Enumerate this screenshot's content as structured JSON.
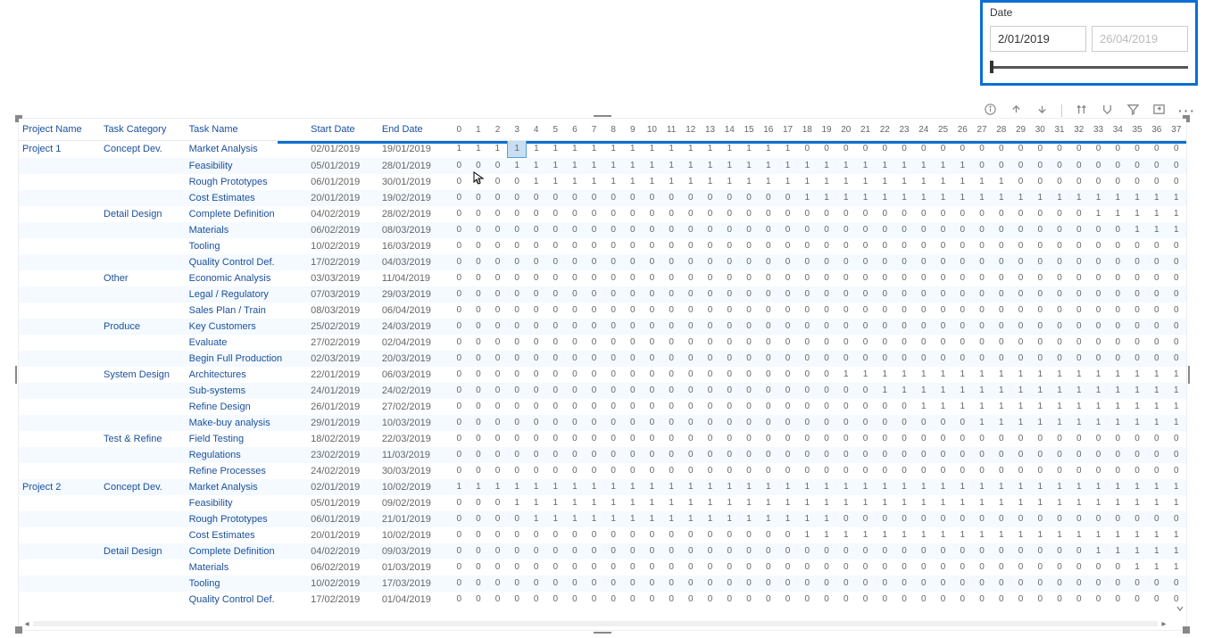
{
  "slicer": {
    "title": "Date",
    "from": "2/01/2019",
    "to": "26/04/2019"
  },
  "toolbar_icons": [
    "arrow-up",
    "arrow-down",
    "divider",
    "drill",
    "filter",
    "focus",
    "more"
  ],
  "headers": {
    "project": "Project Name",
    "category": "Task Category",
    "task": "Task Name",
    "start": "Start Date",
    "end": "End Date"
  },
  "dayColumns": [
    0,
    1,
    2,
    3,
    4,
    5,
    6,
    7,
    8,
    9,
    10,
    11,
    12,
    13,
    14,
    15,
    16,
    17,
    18,
    19,
    20,
    21,
    22,
    23,
    24,
    25,
    26,
    27,
    28,
    29,
    30,
    31,
    32,
    33,
    34,
    35,
    36,
    37
  ],
  "selectedCell": {
    "rowIndex": 0,
    "dayIndex": 3
  },
  "rows": [
    {
      "project": "Project 1",
      "category": "Concept Dev.",
      "task": "Market Analysis",
      "start": "02/01/2019",
      "end": "19/01/2019",
      "vals": [
        1,
        1,
        1,
        1,
        1,
        1,
        1,
        1,
        1,
        1,
        1,
        1,
        1,
        1,
        1,
        1,
        1,
        1,
        0,
        0,
        0,
        0,
        0,
        0,
        0,
        0,
        0,
        0,
        0,
        0,
        0,
        0,
        0,
        0,
        0,
        0,
        0,
        0
      ]
    },
    {
      "project": "",
      "category": "",
      "task": "Feasibility",
      "start": "05/01/2019",
      "end": "28/01/2019",
      "vals": [
        0,
        0,
        0,
        1,
        1,
        1,
        1,
        1,
        1,
        1,
        1,
        1,
        1,
        1,
        1,
        1,
        1,
        1,
        1,
        1,
        1,
        1,
        1,
        1,
        1,
        1,
        1,
        0,
        0,
        0,
        0,
        0,
        0,
        0,
        0,
        0,
        0,
        0
      ]
    },
    {
      "project": "",
      "category": "",
      "task": "Rough Prototypes",
      "start": "06/01/2019",
      "end": "30/01/2019",
      "vals": [
        0,
        0,
        0,
        0,
        1,
        1,
        1,
        1,
        1,
        1,
        1,
        1,
        1,
        1,
        1,
        1,
        1,
        1,
        1,
        1,
        1,
        1,
        1,
        1,
        1,
        1,
        1,
        1,
        1,
        0,
        0,
        0,
        0,
        0,
        0,
        0,
        0,
        0
      ]
    },
    {
      "project": "",
      "category": "",
      "task": "Cost Estimates",
      "start": "20/01/2019",
      "end": "19/02/2019",
      "vals": [
        0,
        0,
        0,
        0,
        0,
        0,
        0,
        0,
        0,
        0,
        0,
        0,
        0,
        0,
        0,
        0,
        0,
        0,
        1,
        1,
        1,
        1,
        1,
        1,
        1,
        1,
        1,
        1,
        1,
        1,
        1,
        1,
        1,
        1,
        1,
        1,
        1,
        1
      ]
    },
    {
      "project": "",
      "category": "Detail Design",
      "task": "Complete Definition",
      "start": "04/02/2019",
      "end": "28/02/2019",
      "vals": [
        0,
        0,
        0,
        0,
        0,
        0,
        0,
        0,
        0,
        0,
        0,
        0,
        0,
        0,
        0,
        0,
        0,
        0,
        0,
        0,
        0,
        0,
        0,
        0,
        0,
        0,
        0,
        0,
        0,
        0,
        0,
        0,
        0,
        1,
        1,
        1,
        1,
        1
      ]
    },
    {
      "project": "",
      "category": "",
      "task": "Materials",
      "start": "06/02/2019",
      "end": "08/03/2019",
      "vals": [
        0,
        0,
        0,
        0,
        0,
        0,
        0,
        0,
        0,
        0,
        0,
        0,
        0,
        0,
        0,
        0,
        0,
        0,
        0,
        0,
        0,
        0,
        0,
        0,
        0,
        0,
        0,
        0,
        0,
        0,
        0,
        0,
        0,
        0,
        0,
        1,
        1,
        1
      ]
    },
    {
      "project": "",
      "category": "",
      "task": "Tooling",
      "start": "10/02/2019",
      "end": "16/03/2019",
      "vals": [
        0,
        0,
        0,
        0,
        0,
        0,
        0,
        0,
        0,
        0,
        0,
        0,
        0,
        0,
        0,
        0,
        0,
        0,
        0,
        0,
        0,
        0,
        0,
        0,
        0,
        0,
        0,
        0,
        0,
        0,
        0,
        0,
        0,
        0,
        0,
        0,
        0,
        0
      ]
    },
    {
      "project": "",
      "category": "",
      "task": "Quality Control Def.",
      "start": "17/02/2019",
      "end": "04/03/2019",
      "vals": [
        0,
        0,
        0,
        0,
        0,
        0,
        0,
        0,
        0,
        0,
        0,
        0,
        0,
        0,
        0,
        0,
        0,
        0,
        0,
        0,
        0,
        0,
        0,
        0,
        0,
        0,
        0,
        0,
        0,
        0,
        0,
        0,
        0,
        0,
        0,
        0,
        0,
        0
      ]
    },
    {
      "project": "",
      "category": "Other",
      "task": "Economic Analysis",
      "start": "03/03/2019",
      "end": "11/04/2019",
      "vals": [
        0,
        0,
        0,
        0,
        0,
        0,
        0,
        0,
        0,
        0,
        0,
        0,
        0,
        0,
        0,
        0,
        0,
        0,
        0,
        0,
        0,
        0,
        0,
        0,
        0,
        0,
        0,
        0,
        0,
        0,
        0,
        0,
        0,
        0,
        0,
        0,
        0,
        0
      ]
    },
    {
      "project": "",
      "category": "",
      "task": "Legal / Regulatory",
      "start": "07/03/2019",
      "end": "29/03/2019",
      "vals": [
        0,
        0,
        0,
        0,
        0,
        0,
        0,
        0,
        0,
        0,
        0,
        0,
        0,
        0,
        0,
        0,
        0,
        0,
        0,
        0,
        0,
        0,
        0,
        0,
        0,
        0,
        0,
        0,
        0,
        0,
        0,
        0,
        0,
        0,
        0,
        0,
        0,
        0
      ]
    },
    {
      "project": "",
      "category": "",
      "task": "Sales Plan / Train",
      "start": "08/03/2019",
      "end": "06/04/2019",
      "vals": [
        0,
        0,
        0,
        0,
        0,
        0,
        0,
        0,
        0,
        0,
        0,
        0,
        0,
        0,
        0,
        0,
        0,
        0,
        0,
        0,
        0,
        0,
        0,
        0,
        0,
        0,
        0,
        0,
        0,
        0,
        0,
        0,
        0,
        0,
        0,
        0,
        0,
        0
      ]
    },
    {
      "project": "",
      "category": "Produce",
      "task": "Key Customers",
      "start": "25/02/2019",
      "end": "24/03/2019",
      "vals": [
        0,
        0,
        0,
        0,
        0,
        0,
        0,
        0,
        0,
        0,
        0,
        0,
        0,
        0,
        0,
        0,
        0,
        0,
        0,
        0,
        0,
        0,
        0,
        0,
        0,
        0,
        0,
        0,
        0,
        0,
        0,
        0,
        0,
        0,
        0,
        0,
        0,
        0
      ]
    },
    {
      "project": "",
      "category": "",
      "task": "Evaluate",
      "start": "27/02/2019",
      "end": "02/04/2019",
      "vals": [
        0,
        0,
        0,
        0,
        0,
        0,
        0,
        0,
        0,
        0,
        0,
        0,
        0,
        0,
        0,
        0,
        0,
        0,
        0,
        0,
        0,
        0,
        0,
        0,
        0,
        0,
        0,
        0,
        0,
        0,
        0,
        0,
        0,
        0,
        0,
        0,
        0,
        0
      ]
    },
    {
      "project": "",
      "category": "",
      "task": "Begin Full Production",
      "start": "02/03/2019",
      "end": "20/03/2019",
      "vals": [
        0,
        0,
        0,
        0,
        0,
        0,
        0,
        0,
        0,
        0,
        0,
        0,
        0,
        0,
        0,
        0,
        0,
        0,
        0,
        0,
        0,
        0,
        0,
        0,
        0,
        0,
        0,
        0,
        0,
        0,
        0,
        0,
        0,
        0,
        0,
        0,
        0,
        0
      ]
    },
    {
      "project": "",
      "category": "System Design",
      "task": "Architectures",
      "start": "22/01/2019",
      "end": "06/03/2019",
      "vals": [
        0,
        0,
        0,
        0,
        0,
        0,
        0,
        0,
        0,
        0,
        0,
        0,
        0,
        0,
        0,
        0,
        0,
        0,
        0,
        0,
        1,
        1,
        1,
        1,
        1,
        1,
        1,
        1,
        1,
        1,
        1,
        1,
        1,
        1,
        1,
        1,
        1,
        1
      ]
    },
    {
      "project": "",
      "category": "",
      "task": "Sub-systems",
      "start": "24/01/2019",
      "end": "24/02/2019",
      "vals": [
        0,
        0,
        0,
        0,
        0,
        0,
        0,
        0,
        0,
        0,
        0,
        0,
        0,
        0,
        0,
        0,
        0,
        0,
        0,
        0,
        0,
        0,
        1,
        1,
        1,
        1,
        1,
        1,
        1,
        1,
        1,
        1,
        1,
        1,
        1,
        1,
        1,
        1
      ]
    },
    {
      "project": "",
      "category": "",
      "task": "Refine Design",
      "start": "26/01/2019",
      "end": "27/02/2019",
      "vals": [
        0,
        0,
        0,
        0,
        0,
        0,
        0,
        0,
        0,
        0,
        0,
        0,
        0,
        0,
        0,
        0,
        0,
        0,
        0,
        0,
        0,
        0,
        0,
        0,
        1,
        1,
        1,
        1,
        1,
        1,
        1,
        1,
        1,
        1,
        1,
        1,
        1,
        1
      ]
    },
    {
      "project": "",
      "category": "",
      "task": "Make-buy analysis",
      "start": "29/01/2019",
      "end": "10/03/2019",
      "vals": [
        0,
        0,
        0,
        0,
        0,
        0,
        0,
        0,
        0,
        0,
        0,
        0,
        0,
        0,
        0,
        0,
        0,
        0,
        0,
        0,
        0,
        0,
        0,
        0,
        0,
        0,
        0,
        1,
        1,
        1,
        1,
        1,
        1,
        1,
        1,
        1,
        1,
        1
      ]
    },
    {
      "project": "",
      "category": "Test & Refine",
      "task": "Field Testing",
      "start": "18/02/2019",
      "end": "22/03/2019",
      "vals": [
        0,
        0,
        0,
        0,
        0,
        0,
        0,
        0,
        0,
        0,
        0,
        0,
        0,
        0,
        0,
        0,
        0,
        0,
        0,
        0,
        0,
        0,
        0,
        0,
        0,
        0,
        0,
        0,
        0,
        0,
        0,
        0,
        0,
        0,
        0,
        0,
        0,
        0
      ]
    },
    {
      "project": "",
      "category": "",
      "task": "Regulations",
      "start": "23/02/2019",
      "end": "11/03/2019",
      "vals": [
        0,
        0,
        0,
        0,
        0,
        0,
        0,
        0,
        0,
        0,
        0,
        0,
        0,
        0,
        0,
        0,
        0,
        0,
        0,
        0,
        0,
        0,
        0,
        0,
        0,
        0,
        0,
        0,
        0,
        0,
        0,
        0,
        0,
        0,
        0,
        0,
        0,
        0
      ]
    },
    {
      "project": "",
      "category": "",
      "task": "Refine Processes",
      "start": "24/02/2019",
      "end": "30/03/2019",
      "vals": [
        0,
        0,
        0,
        0,
        0,
        0,
        0,
        0,
        0,
        0,
        0,
        0,
        0,
        0,
        0,
        0,
        0,
        0,
        0,
        0,
        0,
        0,
        0,
        0,
        0,
        0,
        0,
        0,
        0,
        0,
        0,
        0,
        0,
        0,
        0,
        0,
        0,
        0
      ]
    },
    {
      "project": "Project 2",
      "category": "Concept Dev.",
      "task": "Market Analysis",
      "start": "02/01/2019",
      "end": "10/02/2019",
      "vals": [
        1,
        1,
        1,
        1,
        1,
        1,
        1,
        1,
        1,
        1,
        1,
        1,
        1,
        1,
        1,
        1,
        1,
        1,
        1,
        1,
        1,
        1,
        1,
        1,
        1,
        1,
        1,
        1,
        1,
        1,
        1,
        1,
        1,
        1,
        1,
        1,
        1,
        1
      ]
    },
    {
      "project": "",
      "category": "",
      "task": "Feasibility",
      "start": "05/01/2019",
      "end": "09/02/2019",
      "vals": [
        0,
        0,
        0,
        1,
        1,
        1,
        1,
        1,
        1,
        1,
        1,
        1,
        1,
        1,
        1,
        1,
        1,
        1,
        1,
        1,
        1,
        1,
        1,
        1,
        1,
        1,
        1,
        1,
        1,
        1,
        1,
        1,
        1,
        1,
        1,
        1,
        1,
        1
      ]
    },
    {
      "project": "",
      "category": "",
      "task": "Rough Prototypes",
      "start": "06/01/2019",
      "end": "21/01/2019",
      "vals": [
        0,
        0,
        0,
        0,
        1,
        1,
        1,
        1,
        1,
        1,
        1,
        1,
        1,
        1,
        1,
        1,
        1,
        1,
        1,
        1,
        0,
        0,
        0,
        0,
        0,
        0,
        0,
        0,
        0,
        0,
        0,
        0,
        0,
        0,
        0,
        0,
        0,
        0
      ]
    },
    {
      "project": "",
      "category": "",
      "task": "Cost Estimates",
      "start": "20/01/2019",
      "end": "10/02/2019",
      "vals": [
        0,
        0,
        0,
        0,
        0,
        0,
        0,
        0,
        0,
        0,
        0,
        0,
        0,
        0,
        0,
        0,
        0,
        0,
        1,
        1,
        1,
        1,
        1,
        1,
        1,
        1,
        1,
        1,
        1,
        1,
        1,
        1,
        1,
        1,
        1,
        1,
        1,
        1
      ]
    },
    {
      "project": "",
      "category": "Detail Design",
      "task": "Complete Definition",
      "start": "04/02/2019",
      "end": "09/03/2019",
      "vals": [
        0,
        0,
        0,
        0,
        0,
        0,
        0,
        0,
        0,
        0,
        0,
        0,
        0,
        0,
        0,
        0,
        0,
        0,
        0,
        0,
        0,
        0,
        0,
        0,
        0,
        0,
        0,
        0,
        0,
        0,
        0,
        0,
        0,
        1,
        1,
        1,
        1,
        1
      ]
    },
    {
      "project": "",
      "category": "",
      "task": "Materials",
      "start": "06/02/2019",
      "end": "01/03/2019",
      "vals": [
        0,
        0,
        0,
        0,
        0,
        0,
        0,
        0,
        0,
        0,
        0,
        0,
        0,
        0,
        0,
        0,
        0,
        0,
        0,
        0,
        0,
        0,
        0,
        0,
        0,
        0,
        0,
        0,
        0,
        0,
        0,
        0,
        0,
        0,
        0,
        1,
        1,
        1
      ]
    },
    {
      "project": "",
      "category": "",
      "task": "Tooling",
      "start": "10/02/2019",
      "end": "17/03/2019",
      "vals": [
        0,
        0,
        0,
        0,
        0,
        0,
        0,
        0,
        0,
        0,
        0,
        0,
        0,
        0,
        0,
        0,
        0,
        0,
        0,
        0,
        0,
        0,
        0,
        0,
        0,
        0,
        0,
        0,
        0,
        0,
        0,
        0,
        0,
        0,
        0,
        0,
        0,
        0
      ]
    },
    {
      "project": "",
      "category": "",
      "task": "Quality Control Def.",
      "start": "17/02/2019",
      "end": "01/04/2019",
      "vals": [
        0,
        0,
        0,
        0,
        0,
        0,
        0,
        0,
        0,
        0,
        0,
        0,
        0,
        0,
        0,
        0,
        0,
        0,
        0,
        0,
        0,
        0,
        0,
        0,
        0,
        0,
        0,
        0,
        0,
        0,
        0,
        0,
        0,
        0,
        0,
        0,
        0,
        0
      ]
    }
  ]
}
